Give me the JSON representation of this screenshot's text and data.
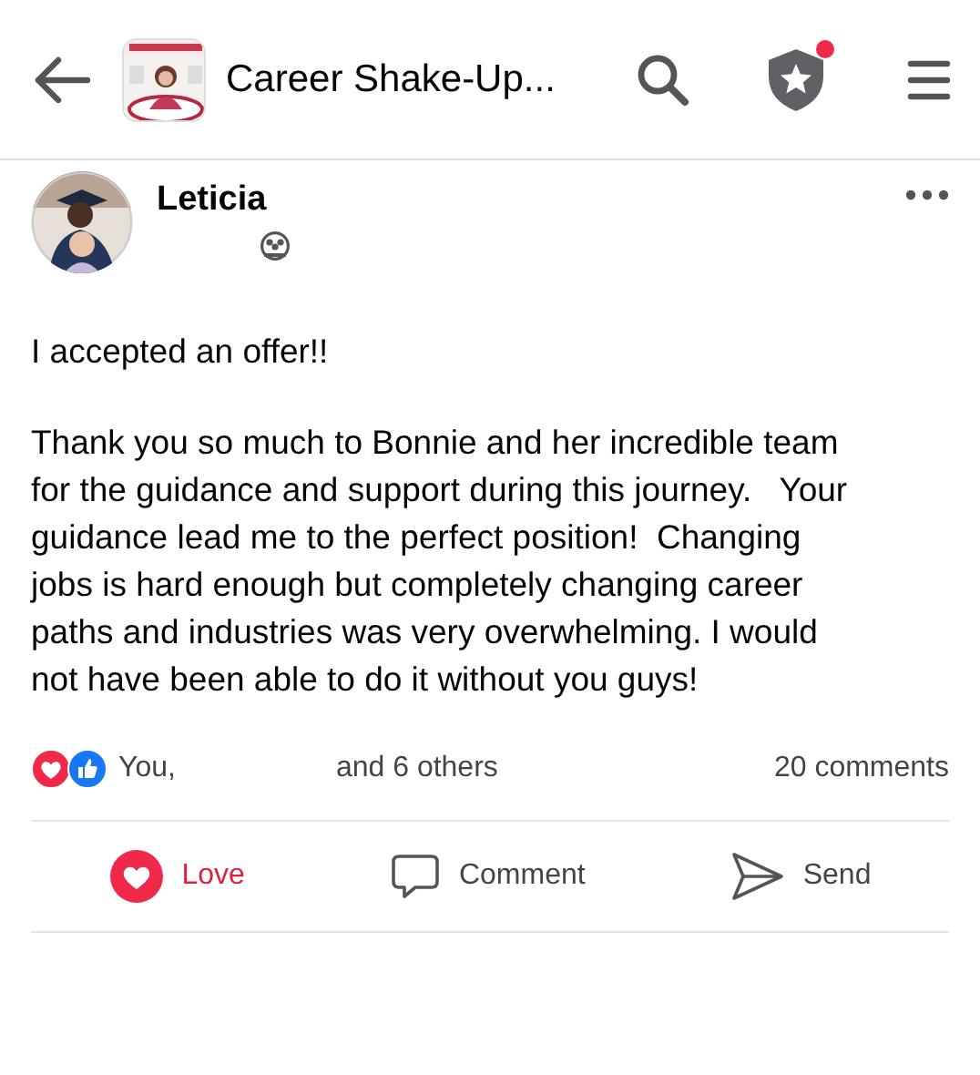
{
  "header": {
    "title": "Career Shake-Up...",
    "notification_dot": true
  },
  "post": {
    "author": "Leticia",
    "paragraphs": [
      [
        "I accepted an offer!!"
      ],
      [
        "Thank you so much to Bonnie and her incredible team",
        "for the guidance and support during this journey.   Your",
        "guidance lead me to the perfect position!  Changing",
        "jobs is hard enough but completely changing career",
        "paths and industries was very overwhelming. I would",
        "not have been able to do it without you guys!"
      ]
    ]
  },
  "reactions": {
    "you": "You,",
    "others": "and 6 others",
    "comments": "20 comments"
  },
  "actions": [
    {
      "kind": "love",
      "label": "Love",
      "selected": true
    },
    {
      "kind": "comment",
      "label": "Comment",
      "selected": false
    },
    {
      "kind": "send",
      "label": "Send",
      "selected": false
    }
  ]
}
